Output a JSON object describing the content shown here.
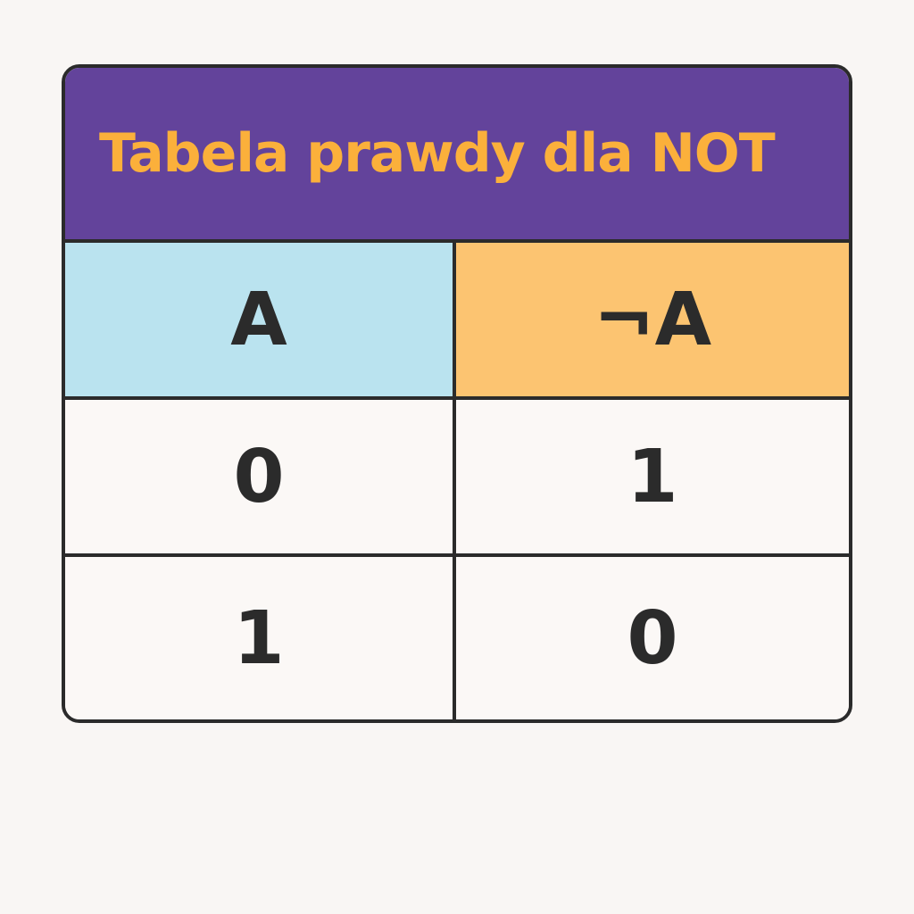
{
  "title": "Tabela prawdy dla NOT",
  "columns": [
    "A",
    "¬A"
  ],
  "rows": [
    [
      "0",
      "1"
    ],
    [
      "1",
      "0"
    ]
  ],
  "colors": {
    "title_background": "#63439b",
    "title_text": "#fbb03b",
    "header_a_background": "#bae3ef",
    "header_not_a_background": "#fcc471",
    "border": "#2b2b2b",
    "cell_background": "#fbf8f6"
  }
}
